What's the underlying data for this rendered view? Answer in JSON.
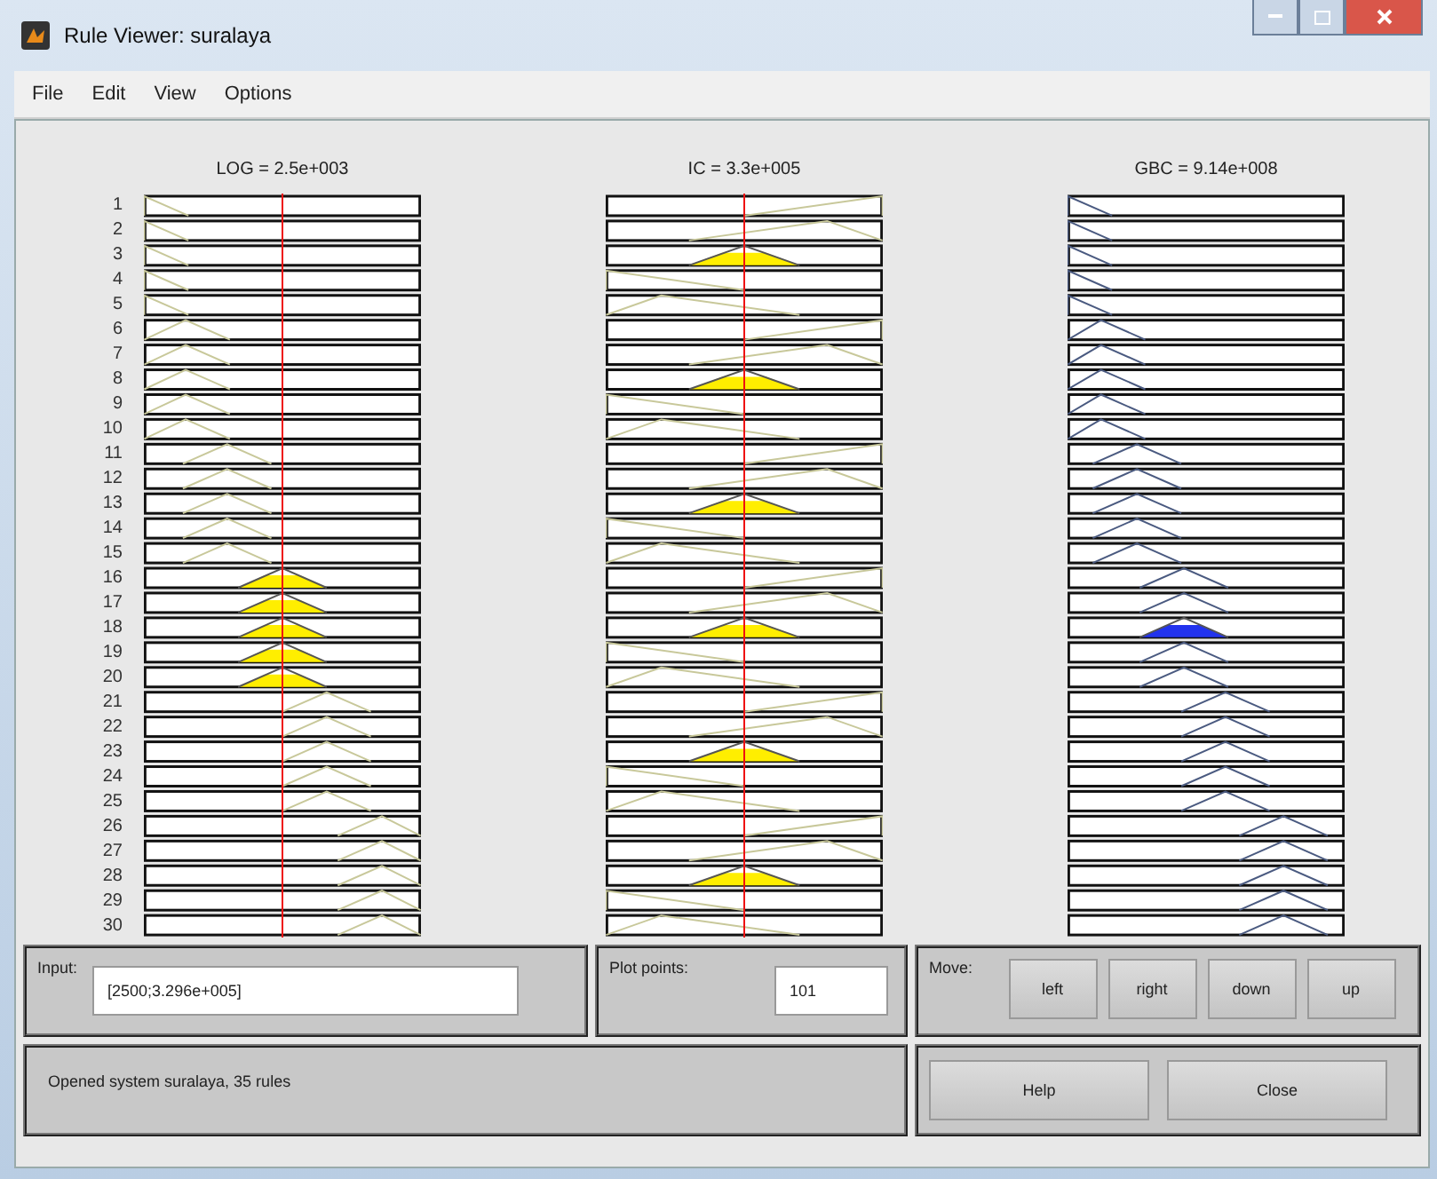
{
  "window": {
    "title": "Rule Viewer: suralaya"
  },
  "menu": [
    "File",
    "Edit",
    "View",
    "Options"
  ],
  "plots": [
    {
      "title": "LOG = 2.5e+003",
      "kind": "input"
    },
    {
      "title": "IC = 3.3e+005",
      "kind": "input"
    },
    {
      "title": "GBC = 9.14e+008",
      "kind": "output"
    }
  ],
  "rule_numbers": [
    "1",
    "2",
    "3",
    "4",
    "5",
    "6",
    "7",
    "8",
    "9",
    "10",
    "11",
    "12",
    "13",
    "14",
    "15",
    "16",
    "17",
    "18",
    "19",
    "20",
    "21",
    "22",
    "23",
    "24",
    "25",
    "26",
    "27",
    "28",
    "29",
    "30"
  ],
  "input": {
    "label": "Input:",
    "value": "[2500;3.296e+005]"
  },
  "plot_points": {
    "label": "Plot points:",
    "value": "101"
  },
  "move": {
    "label": "Move:",
    "buttons": [
      "left",
      "right",
      "down",
      "up"
    ]
  },
  "status": "Opened system suralaya, 35 rules",
  "buttons": [
    "Help",
    "Close"
  ]
}
